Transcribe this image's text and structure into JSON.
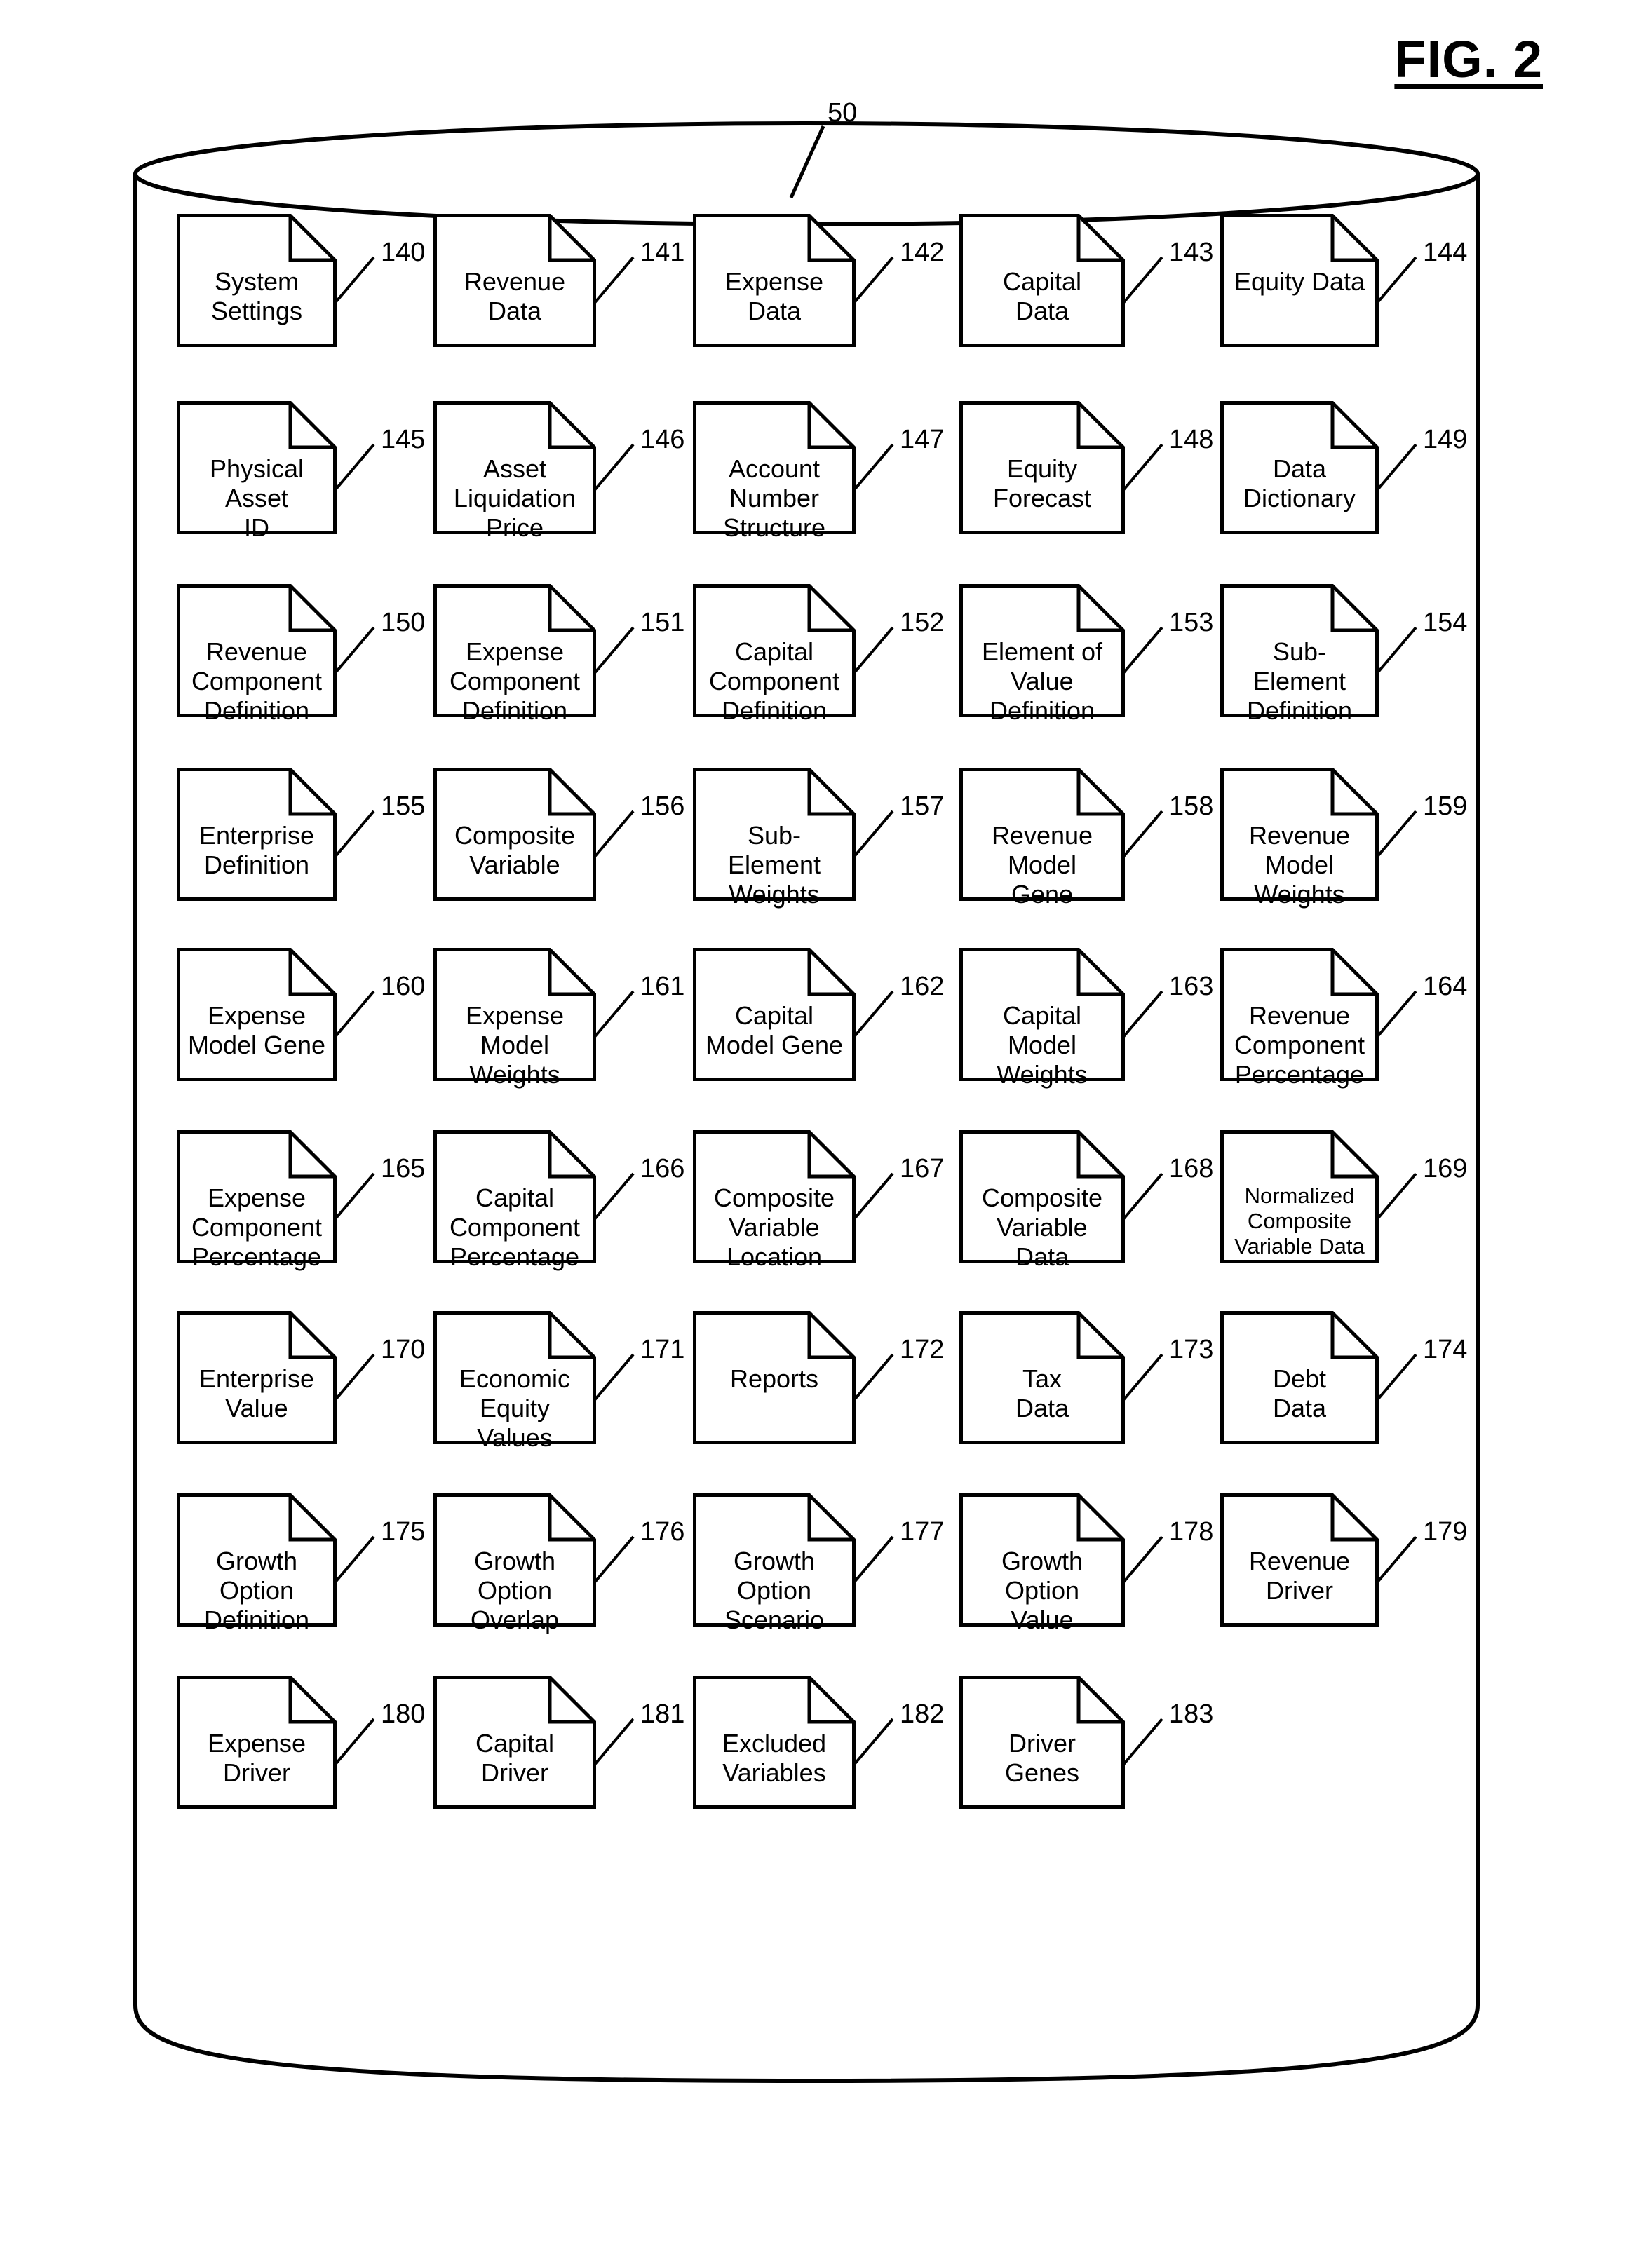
{
  "figure": {
    "title": "FIG. 2",
    "container_ref": "50",
    "container_type": "database-cylinder"
  },
  "documents": [
    {
      "ref": "140",
      "label": "System\nSettings",
      "row": 1,
      "col": 1
    },
    {
      "ref": "141",
      "label": "Revenue\nData",
      "row": 1,
      "col": 2
    },
    {
      "ref": "142",
      "label": "Expense\nData",
      "row": 1,
      "col": 3
    },
    {
      "ref": "143",
      "label": "Capital\nData",
      "row": 1,
      "col": 4
    },
    {
      "ref": "144",
      "label": "Equity Data",
      "row": 1,
      "col": 5
    },
    {
      "ref": "145",
      "label": "Physical\nAsset\nID",
      "row": 2,
      "col": 1
    },
    {
      "ref": "146",
      "label": "Asset\nLiquidation\nPrice",
      "row": 2,
      "col": 2
    },
    {
      "ref": "147",
      "label": "Account\nNumber\nStructure",
      "row": 2,
      "col": 3
    },
    {
      "ref": "148",
      "label": "Equity\nForecast",
      "row": 2,
      "col": 4
    },
    {
      "ref": "149",
      "label": "Data\nDictionary",
      "row": 2,
      "col": 5
    },
    {
      "ref": "150",
      "label": "Revenue\nComponent\nDefinition",
      "row": 3,
      "col": 1
    },
    {
      "ref": "151",
      "label": "Expense\nComponent\nDefinition",
      "row": 3,
      "col": 2
    },
    {
      "ref": "152",
      "label": "Capital\nComponent\nDefinition",
      "row": 3,
      "col": 3
    },
    {
      "ref": "153",
      "label": "Element of\nValue\nDefinition",
      "row": 3,
      "col": 4
    },
    {
      "ref": "154",
      "label": "Sub-\nElement\nDefinition",
      "row": 3,
      "col": 5
    },
    {
      "ref": "155",
      "label": "Enterprise\nDefinition",
      "row": 4,
      "col": 1
    },
    {
      "ref": "156",
      "label": "Composite\nVariable",
      "row": 4,
      "col": 2
    },
    {
      "ref": "157",
      "label": "Sub-\nElement\nWeights",
      "row": 4,
      "col": 3
    },
    {
      "ref": "158",
      "label": "Revenue\nModel\nGene",
      "row": 4,
      "col": 4
    },
    {
      "ref": "159",
      "label": "Revenue\nModel\nWeights",
      "row": 4,
      "col": 5
    },
    {
      "ref": "160",
      "label": "Expense\nModel Gene",
      "row": 5,
      "col": 1
    },
    {
      "ref": "161",
      "label": "Expense\nModel\nWeights",
      "row": 5,
      "col": 2
    },
    {
      "ref": "162",
      "label": "Capital\nModel Gene",
      "row": 5,
      "col": 3
    },
    {
      "ref": "163",
      "label": "Capital\nModel\nWeights",
      "row": 5,
      "col": 4
    },
    {
      "ref": "164",
      "label": "Revenue\nComponent\nPercentage",
      "row": 5,
      "col": 5
    },
    {
      "ref": "165",
      "label": "Expense\nComponent\nPercentage",
      "row": 6,
      "col": 1
    },
    {
      "ref": "166",
      "label": "Capital\nComponent\nPercentage",
      "row": 6,
      "col": 2
    },
    {
      "ref": "167",
      "label": "Composite\nVariable\nLocation",
      "row": 6,
      "col": 3
    },
    {
      "ref": "168",
      "label": "Composite\nVariable\nData",
      "row": 6,
      "col": 4
    },
    {
      "ref": "169",
      "label": "Normalized\nComposite\nVariable Data",
      "row": 6,
      "col": 5,
      "size": "small"
    },
    {
      "ref": "170",
      "label": "Enterprise\nValue",
      "row": 7,
      "col": 1
    },
    {
      "ref": "171",
      "label": "Economic\nEquity\nValues",
      "row": 7,
      "col": 2
    },
    {
      "ref": "172",
      "label": "Reports",
      "row": 7,
      "col": 3
    },
    {
      "ref": "173",
      "label": "Tax\nData",
      "row": 7,
      "col": 4
    },
    {
      "ref": "174",
      "label": "Debt\nData",
      "row": 7,
      "col": 5
    },
    {
      "ref": "175",
      "label": "Growth\nOption\nDefinition",
      "row": 8,
      "col": 1
    },
    {
      "ref": "176",
      "label": "Growth\nOption\nOverlap",
      "row": 8,
      "col": 2
    },
    {
      "ref": "177",
      "label": "Growth\nOption\nScenario",
      "row": 8,
      "col": 3
    },
    {
      "ref": "178",
      "label": "Growth\nOption\nValue",
      "row": 8,
      "col": 4
    },
    {
      "ref": "179",
      "label": "Revenue\nDriver",
      "row": 8,
      "col": 5
    },
    {
      "ref": "180",
      "label": "Expense\nDriver",
      "row": 9,
      "col": 1
    },
    {
      "ref": "181",
      "label": "Capital\nDriver",
      "row": 9,
      "col": 2
    },
    {
      "ref": "182",
      "label": "Excluded\nVariables",
      "row": 9,
      "col": 3
    },
    {
      "ref": "183",
      "label": "Driver\nGenes",
      "row": 9,
      "col": 4
    }
  ]
}
